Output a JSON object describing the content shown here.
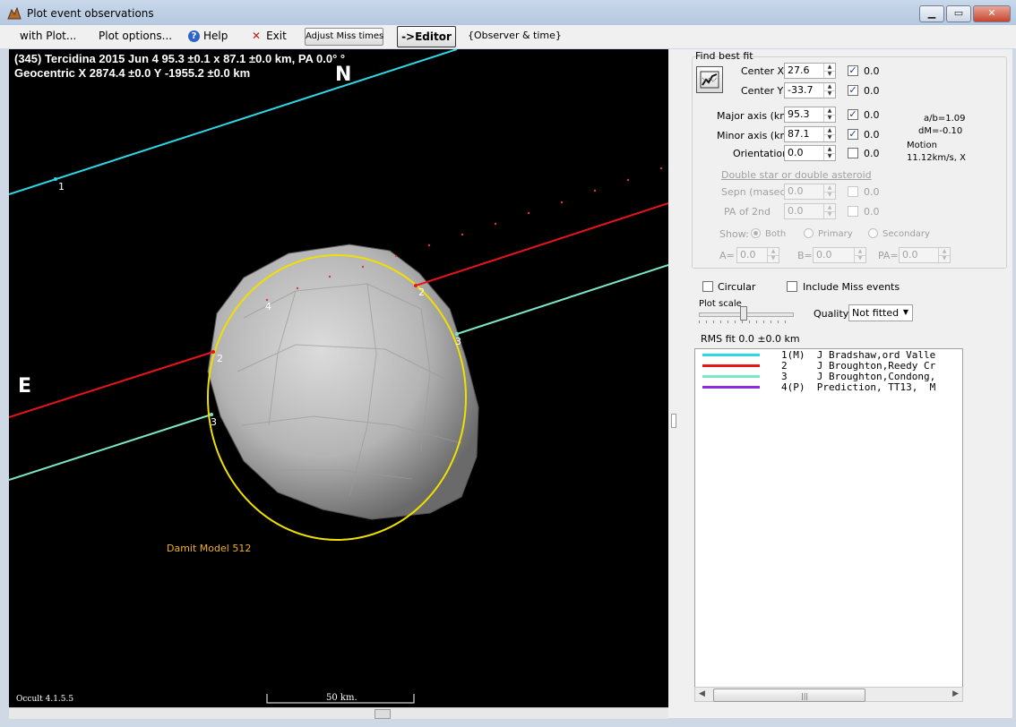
{
  "window": {
    "title": "Plot event observations",
    "buttons": {
      "minimize": "▁",
      "maximize": "▭",
      "close": "✕"
    }
  },
  "menu": {
    "with_plot": "with Plot...",
    "plot_options": "Plot options...",
    "help": "Help",
    "exit": "Exit",
    "adjust_miss": "Adjust Miss times",
    "editor": "->Editor",
    "observer_time": "{Observer & time}"
  },
  "plot": {
    "header_line1": "(345) Tercidina  2015 Jun 4   95.3 ±0.1 x 87.1 ±0.0 km,  PA 0.0° °",
    "header_line2": "Geocentric  X  2874.4 ±0.0  Y -1955.2 ±0.0 km",
    "north": "N",
    "east": "E",
    "model_label": "Damit Model 512",
    "version": "Occult 4.1.5.5",
    "scale_label": "50 km.",
    "chord_labels": {
      "c1": "1",
      "c2_left": "2",
      "c2_right": "2",
      "c3_left": "3",
      "c3_right": "3",
      "c4": "4"
    },
    "colors": {
      "chord1": "#2fd8e8",
      "chord2": "#e8141a",
      "chord3": "#7de6c8",
      "ellipse": "#f0e000",
      "prediction_dots": "#d8365a",
      "model_text": "#f0b020"
    }
  },
  "panel": {
    "find_best_fit": "Find best fit",
    "center_x": {
      "label": "Center X",
      "value": "27.6",
      "checked": true,
      "check_label": "0.0"
    },
    "center_y": {
      "label": "Center Y",
      "value": "-33.7",
      "checked": true,
      "check_label": "0.0"
    },
    "major_axis": {
      "label": "Major axis (km)",
      "value": "95.3",
      "checked": true,
      "check_label": "0.0"
    },
    "minor_axis": {
      "label": "Minor axis (km)",
      "value": "87.1",
      "checked": true,
      "check_label": "0.0"
    },
    "orientation": {
      "label": "Orientation",
      "value": "0.0",
      "checked": false,
      "check_label": "0.0"
    },
    "ratio_info": "a/b=1.09",
    "dm_info": "dM=-0.10",
    "motion_label": "Motion",
    "motion_value": "11.12km/s, X",
    "double_star": "Double star  or  double asteroid",
    "sepn": {
      "label": "Sepn (masec)",
      "value": "0.0",
      "check_label": "0.0"
    },
    "pa2": {
      "label": "PA of 2nd",
      "value": "0.0",
      "check_label": "0.0"
    },
    "show_label": "Show:",
    "show_options": [
      "Both",
      "Primary",
      "Secondary"
    ],
    "a_label": "A=",
    "a_value": "0.0",
    "b_label": "B=",
    "b_value": "0.0",
    "pa_label": "PA=",
    "pa_value": "0.0",
    "circular": "Circular",
    "include_miss": "Include Miss events",
    "plot_scale": "Plot scale",
    "quality_label": "Quality",
    "quality_value": "Not fitted",
    "rms_fit": "RMS fit 0.0 ±0.0 km",
    "observers": [
      {
        "text": "1(M)  J Bradshaw,ord Valle",
        "color": "#2fd8e8"
      },
      {
        "text": "2     J Broughton,Reedy Cr",
        "color": "#e8141a"
      },
      {
        "text": "3     J Broughton,Condong,",
        "color": "#7de6c8"
      },
      {
        "text": "4(P)  Prediction, TT13,  M",
        "color": "#8a2be2"
      }
    ]
  }
}
